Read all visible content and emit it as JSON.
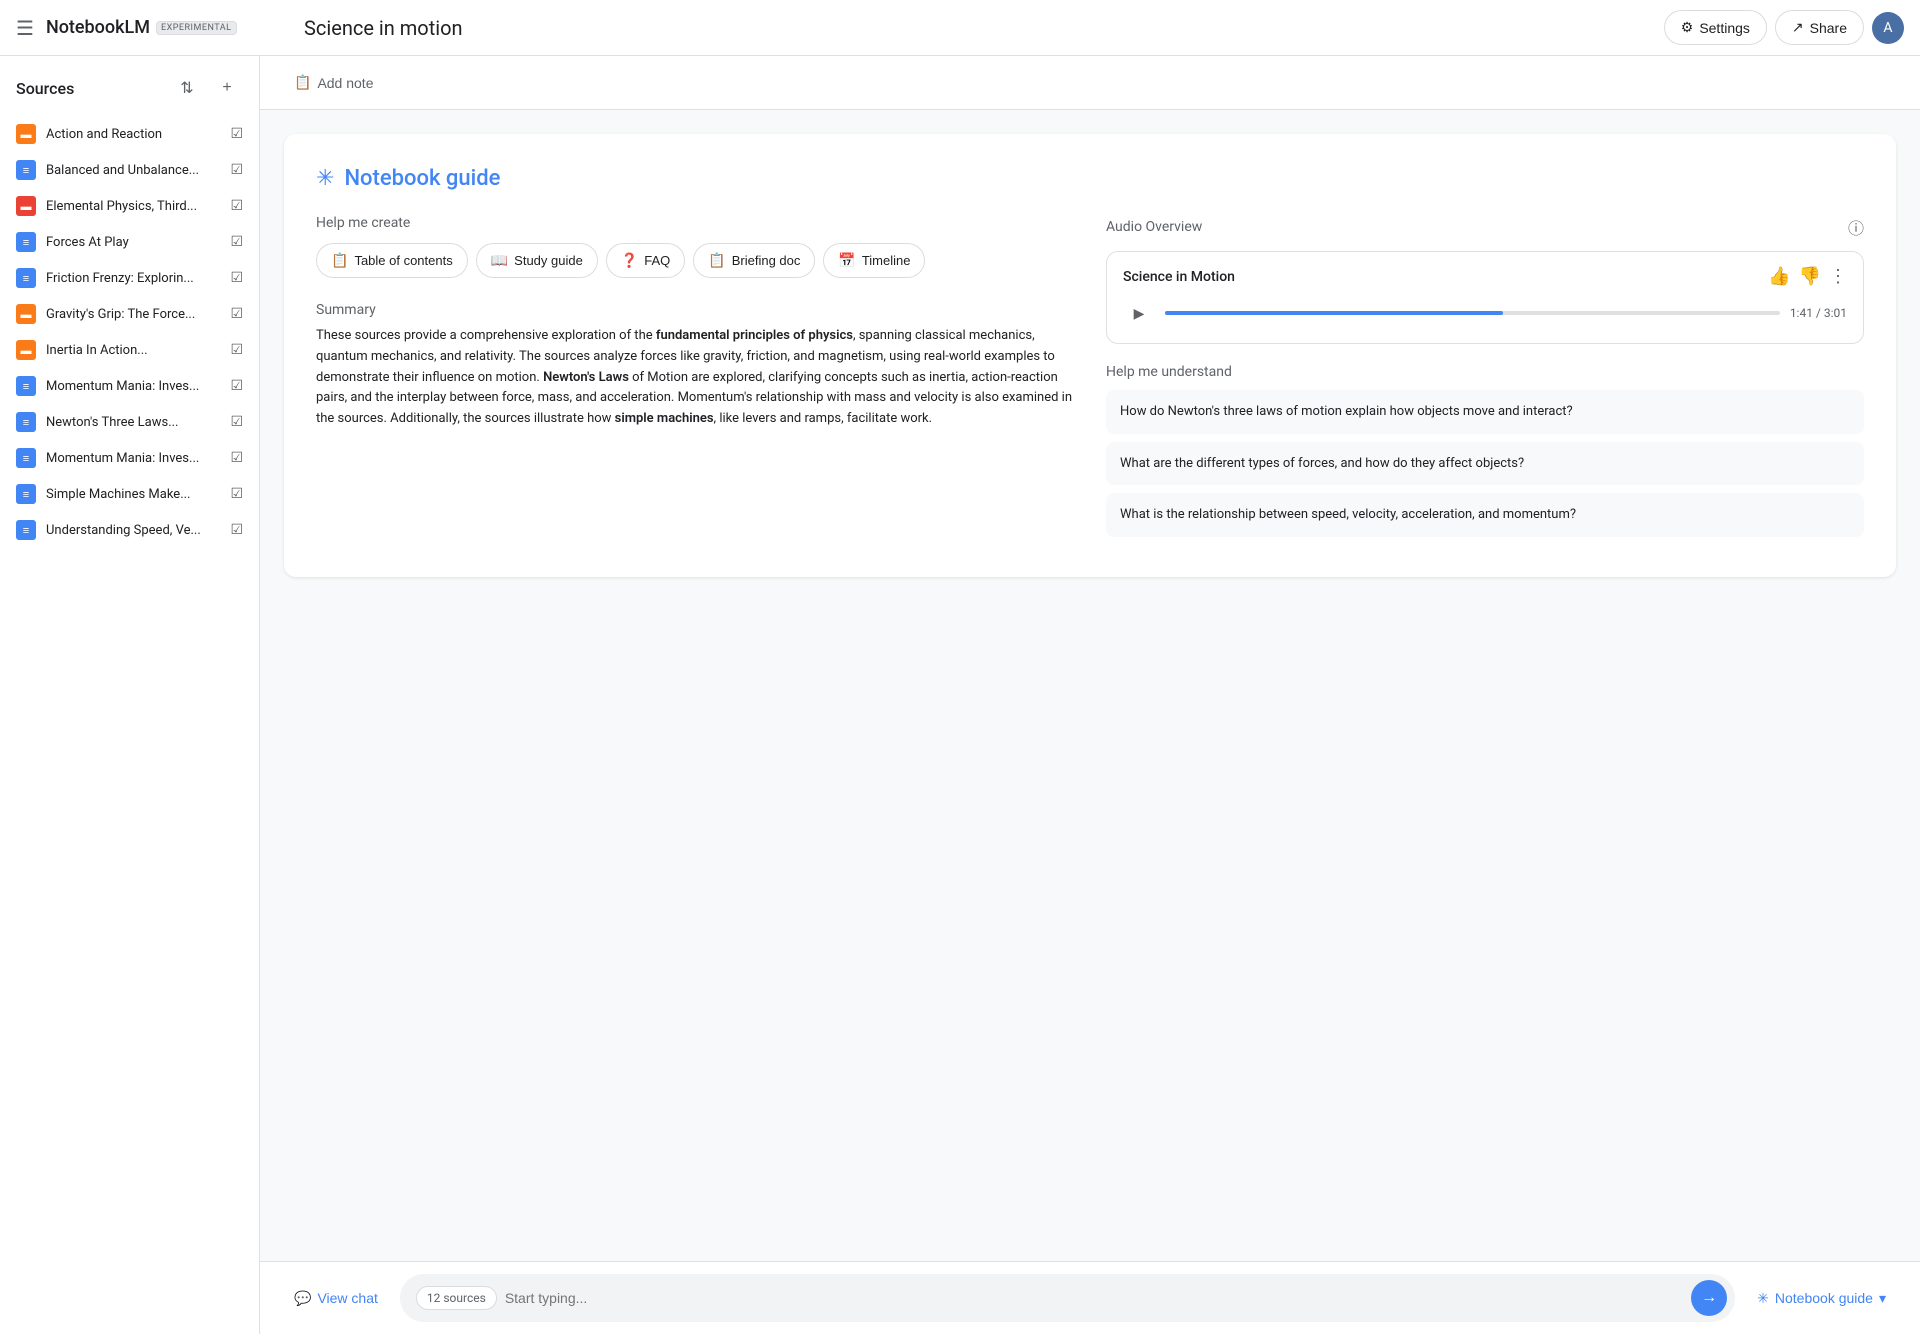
{
  "topbar": {
    "menu_label": "☰",
    "brand_name": "NotebookLM",
    "brand_badge": "EXPERIMENTAL",
    "notebook_title": "Science in motion",
    "settings_label": "Settings",
    "share_label": "Share",
    "avatar_letter": "A"
  },
  "sidebar": {
    "title": "Sources",
    "sources": [
      {
        "id": 1,
        "name": "Action and Reaction",
        "icon_type": "orange",
        "icon_glyph": "▬",
        "checked": true
      },
      {
        "id": 2,
        "name": "Balanced and Unbalance...",
        "icon_type": "blue",
        "icon_glyph": "≡",
        "checked": true
      },
      {
        "id": 3,
        "name": "Elemental Physics, Third...",
        "icon_type": "red",
        "icon_glyph": "▬",
        "checked": true
      },
      {
        "id": 4,
        "name": "Forces At Play",
        "icon_type": "blue",
        "icon_glyph": "≡",
        "checked": true
      },
      {
        "id": 5,
        "name": "Friction Frenzy: Explorin...",
        "icon_type": "blue",
        "icon_glyph": "≡",
        "checked": true
      },
      {
        "id": 6,
        "name": "Gravity's Grip: The Force...",
        "icon_type": "orange",
        "icon_glyph": "▬",
        "checked": true
      },
      {
        "id": 7,
        "name": "Inertia In Action...",
        "icon_type": "orange",
        "icon_glyph": "▬",
        "checked": true
      },
      {
        "id": 8,
        "name": "Momentum Mania: Inves...",
        "icon_type": "blue",
        "icon_glyph": "≡",
        "checked": true
      },
      {
        "id": 9,
        "name": "Newton's Three Laws...",
        "icon_type": "blue",
        "icon_glyph": "≡",
        "checked": true
      },
      {
        "id": 10,
        "name": "Momentum Mania: Inves...",
        "icon_type": "blue",
        "icon_glyph": "≡",
        "checked": true
      },
      {
        "id": 11,
        "name": "Simple Machines Make...",
        "icon_type": "blue",
        "icon_glyph": "≡",
        "checked": true
      },
      {
        "id": 12,
        "name": "Understanding Speed, Ve...",
        "icon_type": "blue",
        "icon_glyph": "≡",
        "checked": true
      }
    ]
  },
  "add_note": {
    "label": "Add note",
    "icon": "📋"
  },
  "notebook_guide": {
    "star": "✳",
    "title": "Notebook guide",
    "help_me_create_label": "Help me create",
    "buttons": [
      {
        "id": "toc",
        "icon": "📋",
        "label": "Table of contents"
      },
      {
        "id": "study",
        "icon": "📖",
        "label": "Study guide"
      },
      {
        "id": "faq",
        "icon": "❓",
        "label": "FAQ"
      },
      {
        "id": "briefing",
        "icon": "📋",
        "label": "Briefing doc"
      },
      {
        "id": "timeline",
        "icon": "📅",
        "label": "Timeline"
      }
    ],
    "summary_label": "Summary",
    "summary_text_plain": "These sources provide a comprehensive exploration of the ",
    "summary_bold_1": "fundamental principles of physics",
    "summary_text_2": ", spanning classical mechanics, quantum mechanics, and relativity. The sources analyze forces like gravity, friction, and magnetism, using real-world examples to demonstrate their influence on motion. ",
    "summary_bold_2": "Newton's Laws",
    "summary_text_3": " of Motion are explored, clarifying concepts such as inertia, action-reaction pairs, and the interplay between force, mass, and acceleration. Momentum's relationship with mass and velocity is also examined in the sources. Additionally, the sources illustrate how ",
    "summary_bold_3": "simple machines",
    "summary_text_4": ", like levers and ramps, facilitate work.",
    "audio_overview_label": "Audio Overview",
    "audio_title": "Science in Motion",
    "audio_time": "1:41 / 3:01",
    "audio_progress_pct": 55,
    "help_me_understand_label": "Help me understand",
    "understand_questions": [
      {
        "id": 1,
        "text": "How do Newton's three laws of motion explain how objects move and interact?"
      },
      {
        "id": 2,
        "text": "What are the different types of forces, and how do they affect objects?"
      },
      {
        "id": 3,
        "text": "What is the relationship between speed, velocity, acceleration, and momentum?"
      }
    ]
  },
  "bottom_bar": {
    "view_chat_label": "View chat",
    "view_chat_icon": "💬",
    "sources_badge": "12 sources",
    "input_placeholder": "Start typing...",
    "send_icon": "→",
    "notebook_guide_label": "Notebook guide",
    "notebook_guide_icon": "✳"
  }
}
